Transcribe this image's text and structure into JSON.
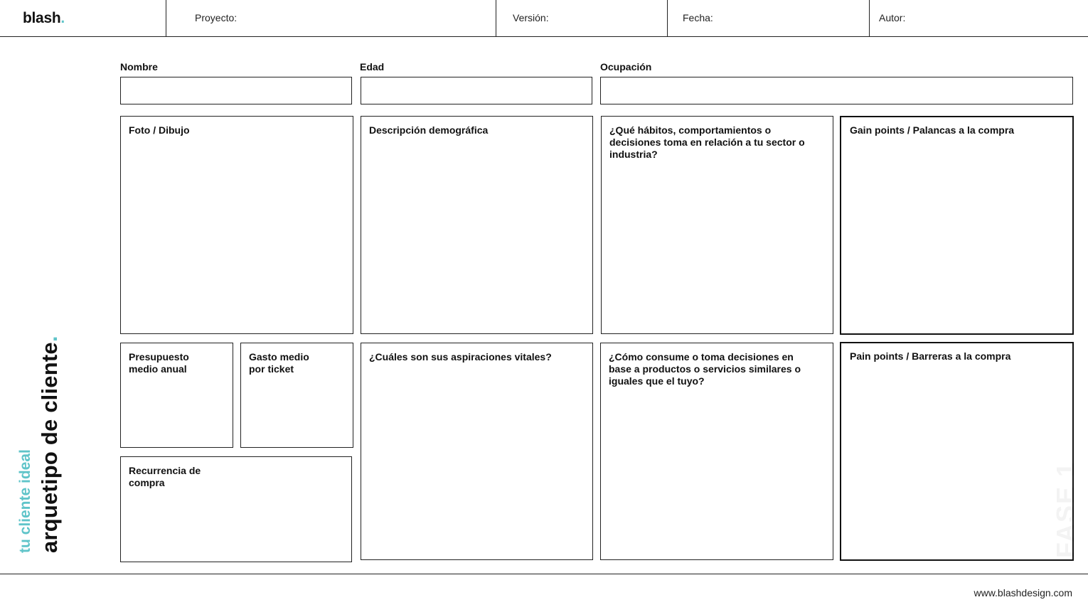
{
  "header": {
    "logo": "blash",
    "logo_dot": ".",
    "fields": [
      "Proyecto:",
      "Versión:",
      "Fecha:",
      "Autor:"
    ]
  },
  "side": {
    "title": "arquetipo de cliente",
    "title_dot": ".",
    "subtitle": "tu cliente ideal",
    "watermark": "FASE 1"
  },
  "profile_fields": {
    "name": "Nombre",
    "age": "Edad",
    "occupation": "Ocupación"
  },
  "boxes": {
    "photo": "Foto / Dibujo",
    "demographics": "Descripción demográfica",
    "habits": "¿Qué hábitos, comportamientos o decisiones toma  en relación a tu sector o industria?",
    "gain_points": "Gain points / Palancas a la compra",
    "budget": "Presupuesto medio anual",
    "ticket": "Gasto medio por ticket",
    "recurrence": "Recurrencia de compra",
    "aspirations": "¿Cuáles son sus aspiraciones vitales?",
    "consumption": "¿Cómo consume o toma decisiones en base a productos o servicios similares o iguales que el tuyo?",
    "pain_points": "Pain points / Barreras a la compra"
  },
  "footer": {
    "website": "www.blashdesign.com"
  },
  "colors": {
    "accent": "#5fc4c9",
    "ink": "#111111"
  }
}
